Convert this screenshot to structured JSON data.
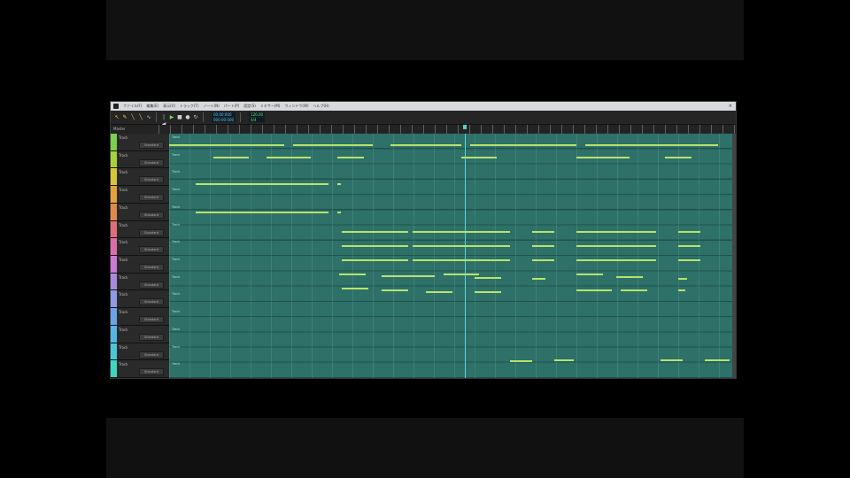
{
  "app": {
    "menus": [
      "ファイル(F)",
      "編集(E)",
      "表示(V)",
      "トラック(T)",
      "ノート(N)",
      "パート(P)",
      "設定(S)",
      "ミキサー(M)",
      "ウィンドウ(W)",
      "ヘルプ(H)"
    ],
    "close_glyph": "×"
  },
  "toolbar": {
    "tools": [
      {
        "icon": "arrow-tool-icon",
        "glyph": "↖"
      },
      {
        "icon": "pencil-tool-icon",
        "glyph": "✎"
      },
      {
        "icon": "line-tool-icon",
        "glyph": "╲"
      },
      {
        "icon": "eraser-tool-icon",
        "glyph": "╲"
      },
      {
        "icon": "vibrato-tool-icon",
        "glyph": "∿"
      }
    ],
    "transport": [
      {
        "icon": "rewind-icon",
        "glyph": "|◀"
      },
      {
        "icon": "play-icon",
        "glyph": "▶"
      },
      {
        "icon": "stop-icon",
        "glyph": "■"
      },
      {
        "icon": "record-icon",
        "glyph": "●"
      },
      {
        "icon": "loop-icon",
        "glyph": "↻"
      }
    ],
    "counter_blue": [
      "00:00:000",
      "000:00:000"
    ],
    "counter_green": [
      "120.00",
      "4/4"
    ]
  },
  "ruler": {
    "label": "Master"
  },
  "tracks": [
    {
      "name": "Track",
      "button": "Standard",
      "color": "#7ad04f"
    },
    {
      "name": "Track",
      "button": "Standard",
      "color": "#a8d23a"
    },
    {
      "name": "Track",
      "button": "Standard",
      "color": "#d8c735"
    },
    {
      "name": "Track",
      "button": "Standard",
      "color": "#e2a43a"
    },
    {
      "name": "Track",
      "button": "Standard",
      "color": "#e08a4a"
    },
    {
      "name": "Track",
      "button": "Standard",
      "color": "#de6f78"
    },
    {
      "name": "Track",
      "button": "Standard",
      "color": "#d96ea8"
    },
    {
      "name": "Track",
      "button": "Standard",
      "color": "#c77bd2"
    },
    {
      "name": "Track",
      "button": "Standard",
      "color": "#a98ae0"
    },
    {
      "name": "Track",
      "button": "Standard",
      "color": "#8e9ae6"
    },
    {
      "name": "Track",
      "button": "Standard",
      "color": "#6aa4e8"
    },
    {
      "name": "Track",
      "button": "Standard",
      "color": "#55b5e6"
    },
    {
      "name": "Track",
      "button": "Standard",
      "color": "#4bc8d8"
    },
    {
      "name": "Track",
      "button": "Standard",
      "color": "#3fd6c0"
    }
  ],
  "lanes": [
    "Track",
    "Track",
    "Track",
    "Track",
    "Track",
    "Track",
    "Track",
    "Track",
    "Track",
    "Track",
    "Track",
    "Track",
    "Track",
    "Track"
  ],
  "colors": {
    "roll": "#2d7169",
    "note": "#b9e36b",
    "playhead": "#5cd3e0"
  }
}
